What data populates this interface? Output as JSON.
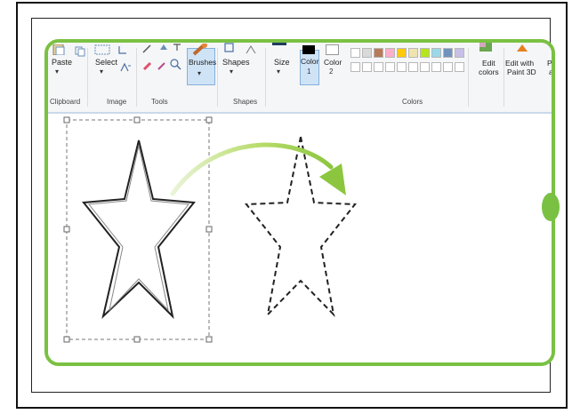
{
  "ribbon": {
    "clipboard": {
      "paste_label": "Paste",
      "group_label": "Clipboard"
    },
    "image": {
      "select_label": "Select",
      "group_label": "Image"
    },
    "tools": {
      "group_label": "Tools"
    },
    "brushes": {
      "label": "Brushes"
    },
    "shapes": {
      "label": "Shapes",
      "group_label": "Shapes"
    },
    "size": {
      "label": "Size"
    },
    "color1": {
      "label": "Color",
      "number": "1"
    },
    "color2": {
      "label": "Color",
      "number": "2"
    },
    "colors": {
      "group_label": "Colors",
      "palette_row1": [
        "#ffffff",
        "#d9d9d9",
        "#b97a57",
        "#ffaec9",
        "#ffc90e",
        "#efe4b0",
        "#b5e61d",
        "#99d9ea",
        "#7092be",
        "#c8bfe7"
      ],
      "palette_row2": [
        "#ffffff",
        "#ffffff",
        "#ffffff",
        "#ffffff",
        "#ffffff",
        "#ffffff",
        "#ffffff",
        "#ffffff",
        "#ffffff",
        "#ffffff"
      ]
    },
    "edit_colors": {
      "label_line1": "Edit",
      "label_line2": "colors"
    },
    "paint3d": {
      "label_line1": "Edit with",
      "label_line2": "Paint 3D"
    },
    "truncated": {
      "label_line1": "Pr",
      "label_line2": "al"
    }
  },
  "colors": {
    "accent_green": "#7ac143",
    "ribbon_bg": "#f5f6f7",
    "selected_bg": "#cfe3f6"
  }
}
